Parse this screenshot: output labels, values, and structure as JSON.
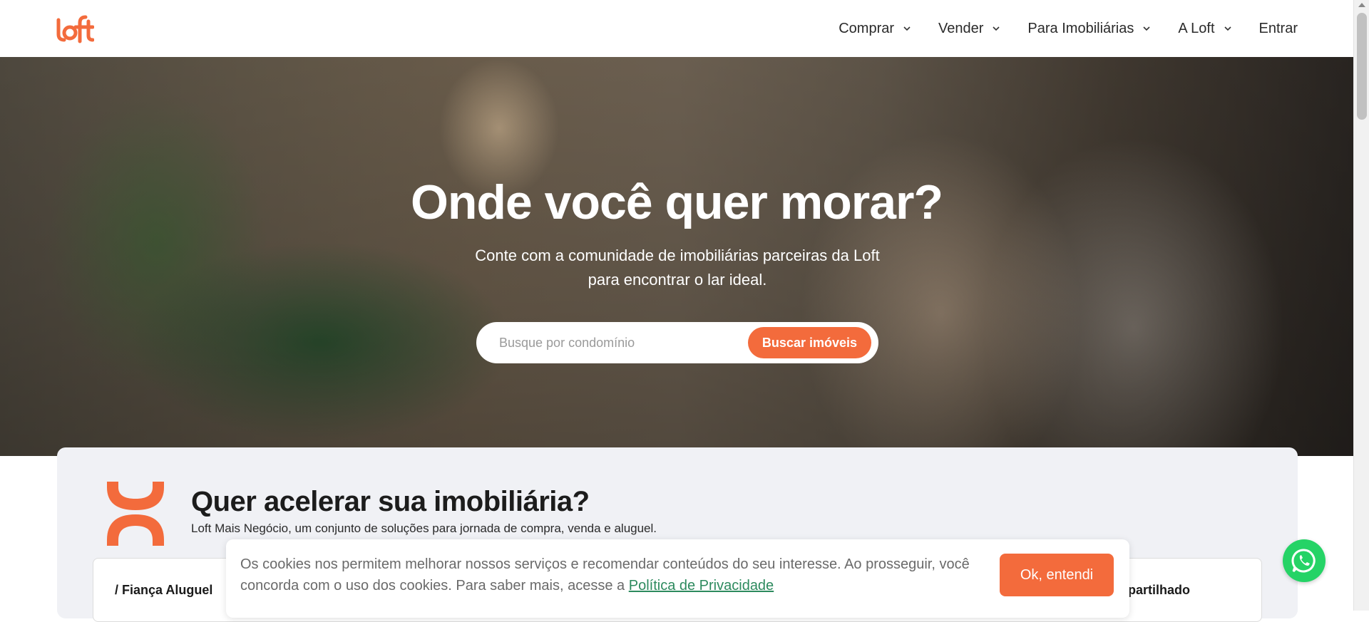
{
  "header": {
    "logo_alt": "loft",
    "nav": [
      {
        "label": "Comprar",
        "has_dropdown": true
      },
      {
        "label": "Vender",
        "has_dropdown": true
      },
      {
        "label": "Para Imobiliárias",
        "has_dropdown": true
      },
      {
        "label": "A Loft",
        "has_dropdown": true
      },
      {
        "label": "Entrar",
        "has_dropdown": false
      }
    ]
  },
  "hero": {
    "title": "Onde você quer morar?",
    "subtitle": "Conte com a comunidade de imobiliárias parceiras da Loft para encontrar o lar ideal.",
    "search_placeholder": "Busque por condomínio",
    "search_button": "Buscar imóveis"
  },
  "card": {
    "title": "Quer acelerar sua imobiliária?",
    "subtitle": "Loft Mais Negócio, um conjunto de soluções para jornada de compra, venda e aluguel.",
    "tab_left": "/ Fiança Aluguel",
    "tab_right": "partilhado"
  },
  "cookie": {
    "text": "Os cookies nos permitem melhorar nossos serviços e recomendar conteúdos do seu interesse. Ao prosseguir, você concorda com o uso dos cookies. Para saber mais, acesse a",
    "link": "Política de Privacidade",
    "button": "Ok, entendi"
  },
  "colors": {
    "accent": "#f36b3c",
    "whatsapp": "#25d366",
    "link": "#2d8a5e"
  },
  "icons": [
    "loft-logo-icon",
    "chevron-down-icon",
    "loft-mais-negocio-icon",
    "whatsapp-icon"
  ]
}
